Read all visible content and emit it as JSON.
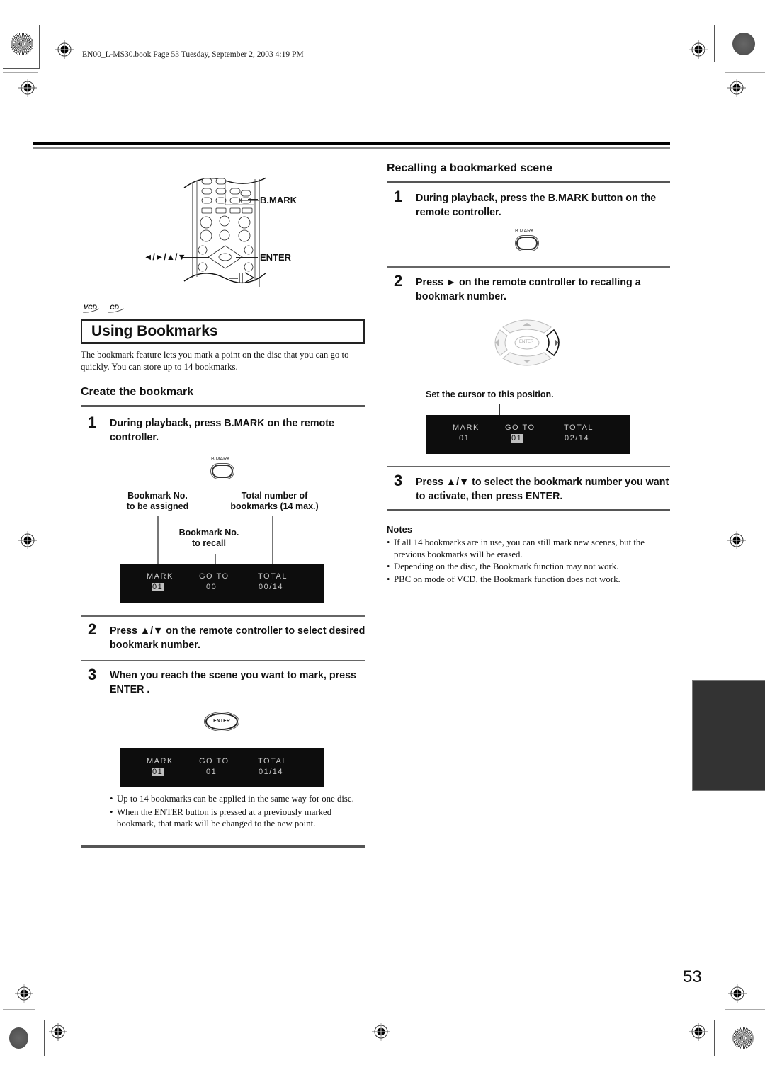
{
  "header": {
    "book_info": "EN00_L-MS30.book  Page 53  Tuesday, September 2, 2003  4:19 PM"
  },
  "remote_diagram": {
    "bmark_label": "B.MARK",
    "arrows_label": "◄/►/▲/▼",
    "enter_label": "ENTER",
    "icons": [
      "remote-control-illustration"
    ]
  },
  "disc_types": [
    "VCD",
    "CD"
  ],
  "section_title": "Using Bookmarks",
  "intro_text": "The bookmark feature lets you mark a point on the disc that you can go to quickly. You can store up to 14 bookmarks.",
  "create": {
    "heading": "Create the bookmark",
    "steps": [
      {
        "num": "1",
        "text": "During playback, press B.MARK on the remote controller."
      },
      {
        "num": "2",
        "text": "Press ▲/▼ on the remote controller to select desired bookmark number."
      },
      {
        "num": "3",
        "text": "When you reach the scene you want to mark, press ENTER ."
      }
    ],
    "bmark_button_label": "B.MARK",
    "enter_button_label": "ENTER",
    "callouts": {
      "mark_line1": "Bookmark No.",
      "mark_line2": "to be assigned",
      "total_line1": "Total number of",
      "total_line2": "bookmarks (14 max.)",
      "goto_line1": "Bookmark No.",
      "goto_line2": "to recall"
    },
    "osd1": {
      "mark_label": "MARK",
      "goto_label": "GO  TO",
      "total_label": "TOTAL",
      "mark_value": "01",
      "goto_value": "00",
      "total_value": "00/14",
      "highlighted": "mark"
    },
    "osd2": {
      "mark_label": "MARK",
      "goto_label": "GO  TO",
      "total_label": "TOTAL",
      "mark_value": "01",
      "goto_value": "01",
      "total_value": "01/14",
      "highlighted": "mark"
    },
    "bullets": [
      "Up to 14 bookmarks can be applied in the same way for one disc.",
      "When the ENTER button is pressed at a previously marked bookmark, that mark will be changed to the new point."
    ]
  },
  "recall": {
    "heading": "Recalling a bookmarked scene",
    "steps": [
      {
        "num": "1",
        "text": "During playback, press the B.MARK button on the remote controller."
      },
      {
        "num": "2",
        "text": "Press ► on the remote controller to recalling a bookmark number."
      },
      {
        "num": "3",
        "text": "Press ▲/▼ to select the bookmark number you want to activate, then press ENTER."
      }
    ],
    "bmark_button_label": "B.MARK",
    "dpad_enter_label": "ENTER",
    "cursor_caption": "Set the cursor to this position.",
    "osd": {
      "mark_label": "MARK",
      "goto_label": "GO  TO",
      "total_label": "TOTAL",
      "mark_value": "01",
      "goto_value": "01",
      "total_value": "02/14",
      "highlighted": "goto"
    }
  },
  "notes": {
    "heading": "Notes",
    "items": [
      "If all 14 bookmarks are in use, you can still mark new scenes, but the previous bookmarks will be erased.",
      "Depending on the disc, the Bookmark function may not work.",
      "PBC on mode of VCD, the Bookmark function does not work."
    ]
  },
  "page_number": "53"
}
